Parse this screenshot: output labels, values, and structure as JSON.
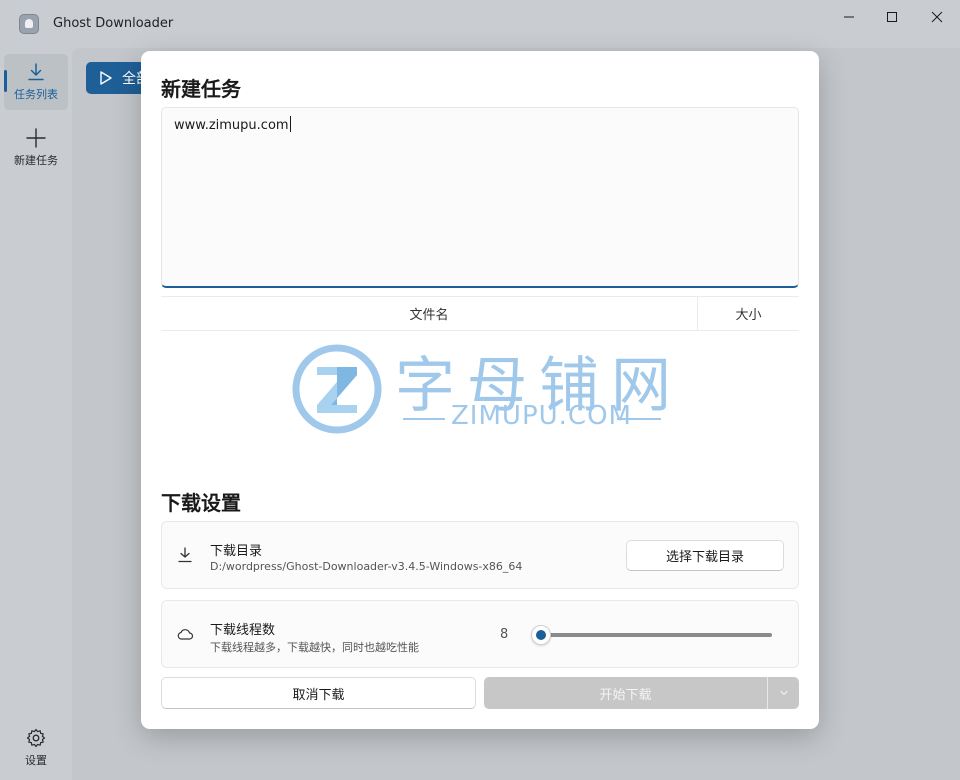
{
  "window": {
    "title": "Ghost Downloader",
    "controls": [
      "minimize-icon",
      "maximize-icon",
      "close-icon"
    ]
  },
  "sidebar": {
    "items": [
      {
        "label": "任务列表",
        "icon": "download-icon",
        "active": true
      },
      {
        "label": "新建任务",
        "icon": "plus-icon",
        "active": false
      }
    ],
    "settings": {
      "label": "设置",
      "icon": "gear-icon"
    }
  },
  "toolbar": {
    "start_all_label": "全部"
  },
  "dialog": {
    "title": "新建任务",
    "url_value": "www.zimupu.com",
    "table": {
      "columns": [
        "文件名",
        "大小"
      ],
      "rows": []
    },
    "watermark": {
      "cn": "字母铺网",
      "en": "ZIMUPU.COM"
    },
    "settings_title": "下载设置",
    "download_dir": {
      "title": "下载目录",
      "path": "D:/wordpress/Ghost-Downloader-v3.4.5-Windows-x86_64",
      "button_label": "选择下载目录",
      "icon": "download-icon"
    },
    "threads": {
      "title": "下载线程数",
      "description": "下载线程越多，下载越快，同时也越吃性能",
      "value": "8",
      "min": 1,
      "max": 256,
      "icon": "cloud-icon"
    },
    "cancel_label": "取消下载",
    "start_label": "开始下载"
  },
  "colors": {
    "accent": "#1c5f98",
    "disabled": "#c7c7c7",
    "watermark": "#9fc8ea"
  }
}
